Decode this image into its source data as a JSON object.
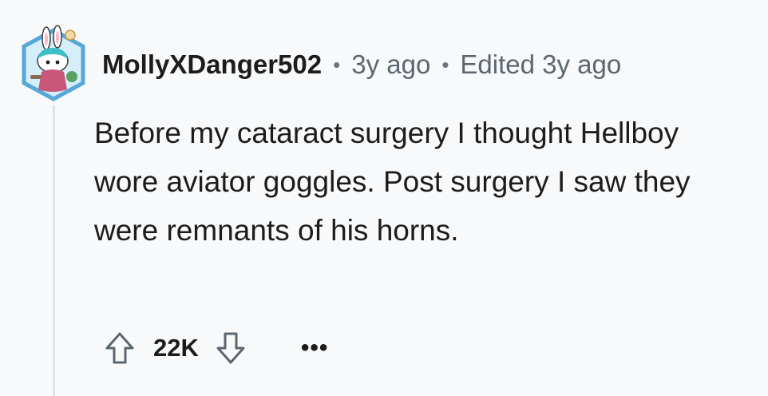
{
  "comment": {
    "author": "MollyXDanger502",
    "age": "3y ago",
    "edited": "Edited 3y ago",
    "separator": "•",
    "body": "Before my cataract surgery I thought Hellboy wore aviator goggles. Post surgery I saw they were remnants of his horns.",
    "score": "22K",
    "more_label": "•••"
  },
  "icons": {
    "upvote": "arrow-up-icon",
    "downvote": "arrow-down-icon",
    "avatar": "snoo-avatar-icon"
  },
  "colors": {
    "background": "#f8f9fa",
    "text": "#1c1c1c",
    "meta": "#5c6670",
    "thread_line": "#dde3e8",
    "avatar_border": "#57a7d8",
    "avatar_bg": "#d6eef9"
  }
}
